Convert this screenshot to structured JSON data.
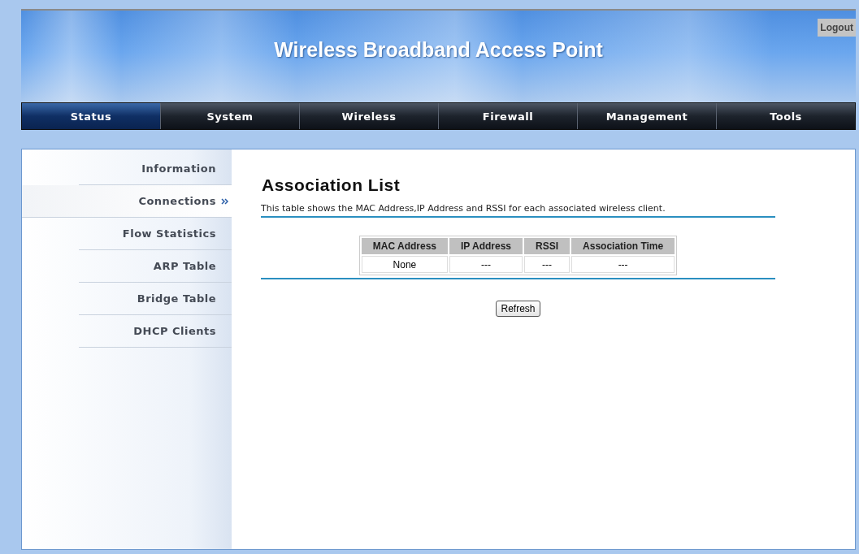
{
  "header": {
    "title": "Wireless Broadband Access Point",
    "logout": "Logout"
  },
  "nav": [
    {
      "label": "Status",
      "selected": true
    },
    {
      "label": "System",
      "selected": false
    },
    {
      "label": "Wireless",
      "selected": false
    },
    {
      "label": "Firewall",
      "selected": false
    },
    {
      "label": "Management",
      "selected": false
    },
    {
      "label": "Tools",
      "selected": false
    }
  ],
  "sidebar": {
    "items": [
      {
        "label": "Information",
        "selected": false
      },
      {
        "label": "Connections",
        "selected": true
      },
      {
        "label": "Flow Statistics",
        "selected": false
      },
      {
        "label": "ARP Table",
        "selected": false
      },
      {
        "label": "Bridge Table",
        "selected": false
      },
      {
        "label": "DHCP Clients",
        "selected": false
      }
    ]
  },
  "page": {
    "title": "Association List",
    "description": "This table shows the MAC Address,IP Address and RSSI for each associated wireless client.",
    "table": {
      "columns": [
        "MAC Address",
        "IP Address",
        "RSSI",
        "Association Time"
      ],
      "rows": [
        [
          "None",
          "---",
          "---",
          "---"
        ]
      ]
    },
    "refresh": "Refresh"
  }
}
